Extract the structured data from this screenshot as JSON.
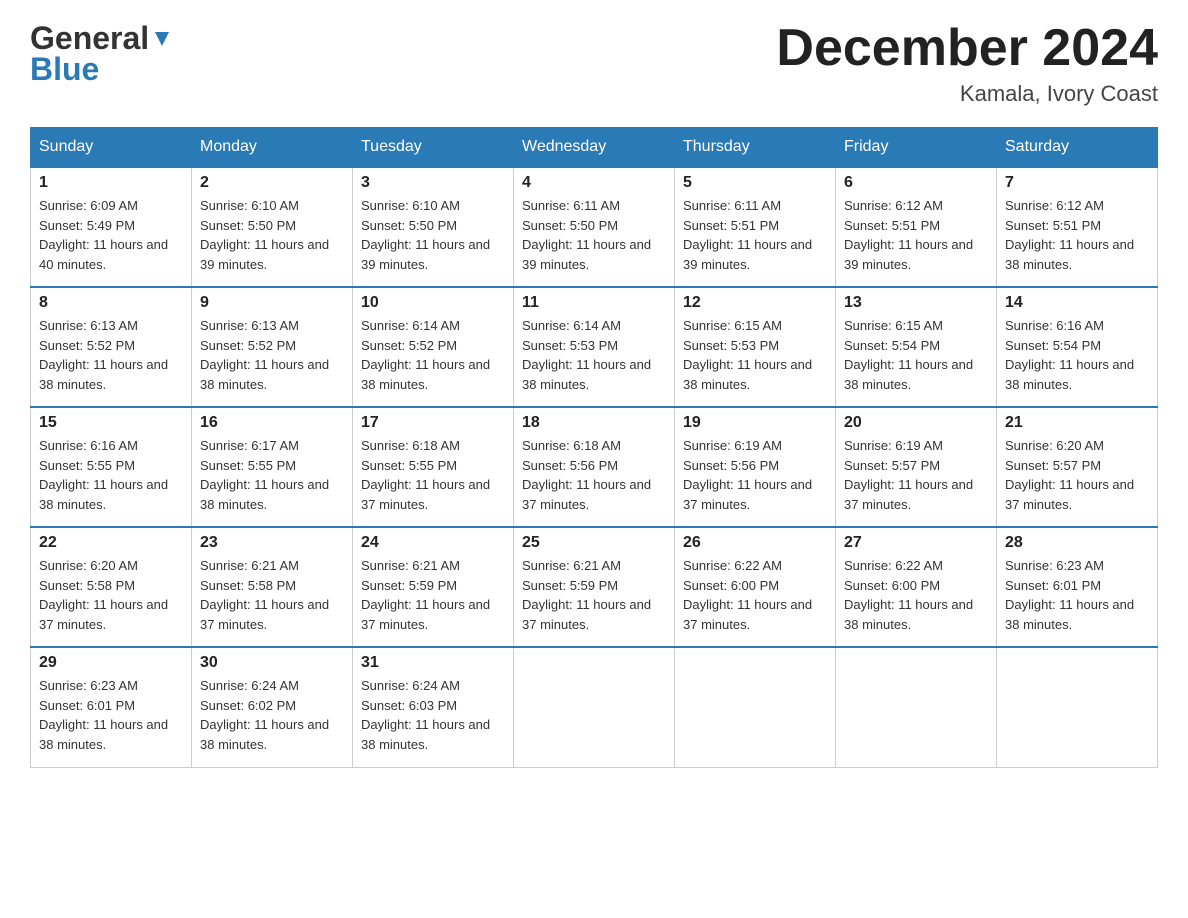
{
  "header": {
    "logo_line1": "General",
    "logo_line2": "Blue",
    "month_title": "December 2024",
    "location": "Kamala, Ivory Coast"
  },
  "days_of_week": [
    "Sunday",
    "Monday",
    "Tuesday",
    "Wednesday",
    "Thursday",
    "Friday",
    "Saturday"
  ],
  "weeks": [
    [
      {
        "day": "1",
        "sunrise": "6:09 AM",
        "sunset": "5:49 PM",
        "daylight": "11 hours and 40 minutes."
      },
      {
        "day": "2",
        "sunrise": "6:10 AM",
        "sunset": "5:50 PM",
        "daylight": "11 hours and 39 minutes."
      },
      {
        "day": "3",
        "sunrise": "6:10 AM",
        "sunset": "5:50 PM",
        "daylight": "11 hours and 39 minutes."
      },
      {
        "day": "4",
        "sunrise": "6:11 AM",
        "sunset": "5:50 PM",
        "daylight": "11 hours and 39 minutes."
      },
      {
        "day": "5",
        "sunrise": "6:11 AM",
        "sunset": "5:51 PM",
        "daylight": "11 hours and 39 minutes."
      },
      {
        "day": "6",
        "sunrise": "6:12 AM",
        "sunset": "5:51 PM",
        "daylight": "11 hours and 39 minutes."
      },
      {
        "day": "7",
        "sunrise": "6:12 AM",
        "sunset": "5:51 PM",
        "daylight": "11 hours and 38 minutes."
      }
    ],
    [
      {
        "day": "8",
        "sunrise": "6:13 AM",
        "sunset": "5:52 PM",
        "daylight": "11 hours and 38 minutes."
      },
      {
        "day": "9",
        "sunrise": "6:13 AM",
        "sunset": "5:52 PM",
        "daylight": "11 hours and 38 minutes."
      },
      {
        "day": "10",
        "sunrise": "6:14 AM",
        "sunset": "5:52 PM",
        "daylight": "11 hours and 38 minutes."
      },
      {
        "day": "11",
        "sunrise": "6:14 AM",
        "sunset": "5:53 PM",
        "daylight": "11 hours and 38 minutes."
      },
      {
        "day": "12",
        "sunrise": "6:15 AM",
        "sunset": "5:53 PM",
        "daylight": "11 hours and 38 minutes."
      },
      {
        "day": "13",
        "sunrise": "6:15 AM",
        "sunset": "5:54 PM",
        "daylight": "11 hours and 38 minutes."
      },
      {
        "day": "14",
        "sunrise": "6:16 AM",
        "sunset": "5:54 PM",
        "daylight": "11 hours and 38 minutes."
      }
    ],
    [
      {
        "day": "15",
        "sunrise": "6:16 AM",
        "sunset": "5:55 PM",
        "daylight": "11 hours and 38 minutes."
      },
      {
        "day": "16",
        "sunrise": "6:17 AM",
        "sunset": "5:55 PM",
        "daylight": "11 hours and 38 minutes."
      },
      {
        "day": "17",
        "sunrise": "6:18 AM",
        "sunset": "5:55 PM",
        "daylight": "11 hours and 37 minutes."
      },
      {
        "day": "18",
        "sunrise": "6:18 AM",
        "sunset": "5:56 PM",
        "daylight": "11 hours and 37 minutes."
      },
      {
        "day": "19",
        "sunrise": "6:19 AM",
        "sunset": "5:56 PM",
        "daylight": "11 hours and 37 minutes."
      },
      {
        "day": "20",
        "sunrise": "6:19 AM",
        "sunset": "5:57 PM",
        "daylight": "11 hours and 37 minutes."
      },
      {
        "day": "21",
        "sunrise": "6:20 AM",
        "sunset": "5:57 PM",
        "daylight": "11 hours and 37 minutes."
      }
    ],
    [
      {
        "day": "22",
        "sunrise": "6:20 AM",
        "sunset": "5:58 PM",
        "daylight": "11 hours and 37 minutes."
      },
      {
        "day": "23",
        "sunrise": "6:21 AM",
        "sunset": "5:58 PM",
        "daylight": "11 hours and 37 minutes."
      },
      {
        "day": "24",
        "sunrise": "6:21 AM",
        "sunset": "5:59 PM",
        "daylight": "11 hours and 37 minutes."
      },
      {
        "day": "25",
        "sunrise": "6:21 AM",
        "sunset": "5:59 PM",
        "daylight": "11 hours and 37 minutes."
      },
      {
        "day": "26",
        "sunrise": "6:22 AM",
        "sunset": "6:00 PM",
        "daylight": "11 hours and 37 minutes."
      },
      {
        "day": "27",
        "sunrise": "6:22 AM",
        "sunset": "6:00 PM",
        "daylight": "11 hours and 38 minutes."
      },
      {
        "day": "28",
        "sunrise": "6:23 AM",
        "sunset": "6:01 PM",
        "daylight": "11 hours and 38 minutes."
      }
    ],
    [
      {
        "day": "29",
        "sunrise": "6:23 AM",
        "sunset": "6:01 PM",
        "daylight": "11 hours and 38 minutes."
      },
      {
        "day": "30",
        "sunrise": "6:24 AM",
        "sunset": "6:02 PM",
        "daylight": "11 hours and 38 minutes."
      },
      {
        "day": "31",
        "sunrise": "6:24 AM",
        "sunset": "6:03 PM",
        "daylight": "11 hours and 38 minutes."
      },
      null,
      null,
      null,
      null
    ]
  ]
}
